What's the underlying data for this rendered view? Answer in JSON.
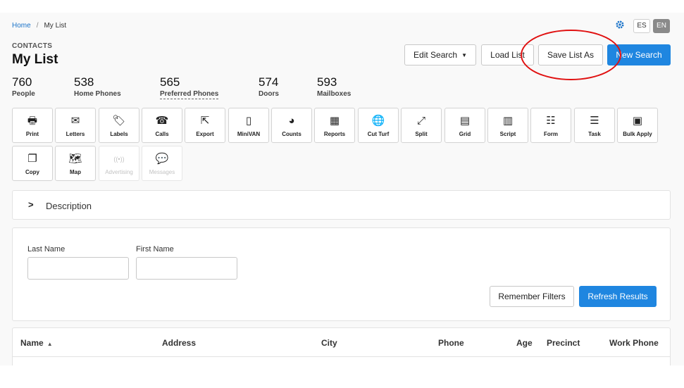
{
  "breadcrumb": {
    "home": "Home",
    "sep": "/",
    "current": "My List"
  },
  "lang": {
    "es": "ES",
    "en": "EN"
  },
  "header": {
    "section": "CONTACTS",
    "title": "My List"
  },
  "actions": {
    "edit_search": "Edit Search",
    "load_list": "Load List",
    "save_list_as": "Save List As",
    "new_search": "New Search"
  },
  "stats": [
    {
      "value": "760",
      "label": "People"
    },
    {
      "value": "538",
      "label": "Home Phones"
    },
    {
      "value": "565",
      "label": "Preferred Phones"
    },
    {
      "value": "574",
      "label": "Doors"
    },
    {
      "value": "593",
      "label": "Mailboxes"
    }
  ],
  "tools": [
    {
      "label": "Print",
      "icon": "printer-icon",
      "glyph": "🖶"
    },
    {
      "label": "Letters",
      "icon": "envelope-icon",
      "glyph": "✉"
    },
    {
      "label": "Labels",
      "icon": "tags-icon",
      "glyph": "🏷"
    },
    {
      "label": "Calls",
      "icon": "phone-icon",
      "glyph": "☎"
    },
    {
      "label": "Export",
      "icon": "export-icon",
      "glyph": "⇱"
    },
    {
      "label": "MiniVAN",
      "icon": "mobile-icon",
      "glyph": "▯"
    },
    {
      "label": "Counts",
      "icon": "pie-chart-icon",
      "glyph": "◕"
    },
    {
      "label": "Reports",
      "icon": "calculator-icon",
      "glyph": "▦"
    },
    {
      "label": "Cut Turf",
      "icon": "globe-icon",
      "glyph": "🌐"
    },
    {
      "label": "Split",
      "icon": "expand-icon",
      "glyph": "⤢"
    },
    {
      "label": "Grid",
      "icon": "grid-icon",
      "glyph": "▤"
    },
    {
      "label": "Script",
      "icon": "script-icon",
      "glyph": "▥"
    },
    {
      "label": "Form",
      "icon": "form-icon",
      "glyph": "☷"
    },
    {
      "label": "Task",
      "icon": "task-list-icon",
      "glyph": "☰"
    },
    {
      "label": "Bulk Apply",
      "icon": "bulk-apply-icon",
      "glyph": "▣"
    },
    {
      "label": "Copy",
      "icon": "copy-icon",
      "glyph": "❐"
    },
    {
      "label": "Map",
      "icon": "map-icon",
      "glyph": "🗺"
    },
    {
      "label": "Advertising",
      "icon": "broadcast-icon",
      "glyph": "((•))",
      "disabled": true
    },
    {
      "label": "Messages",
      "icon": "chat-icon",
      "glyph": "💬",
      "disabled": true
    }
  ],
  "description": {
    "label": "Description"
  },
  "filters": {
    "last_name_label": "Last Name",
    "first_name_label": "First Name",
    "last_name_value": "",
    "first_name_value": "",
    "remember": "Remember Filters",
    "refresh": "Refresh Results"
  },
  "table": {
    "columns": [
      "Name",
      "Address",
      "City",
      "Phone",
      "Age",
      "Precinct",
      "Work Phone"
    ]
  },
  "colors": {
    "accent": "#1f86e0",
    "annotation": "#e01010"
  }
}
